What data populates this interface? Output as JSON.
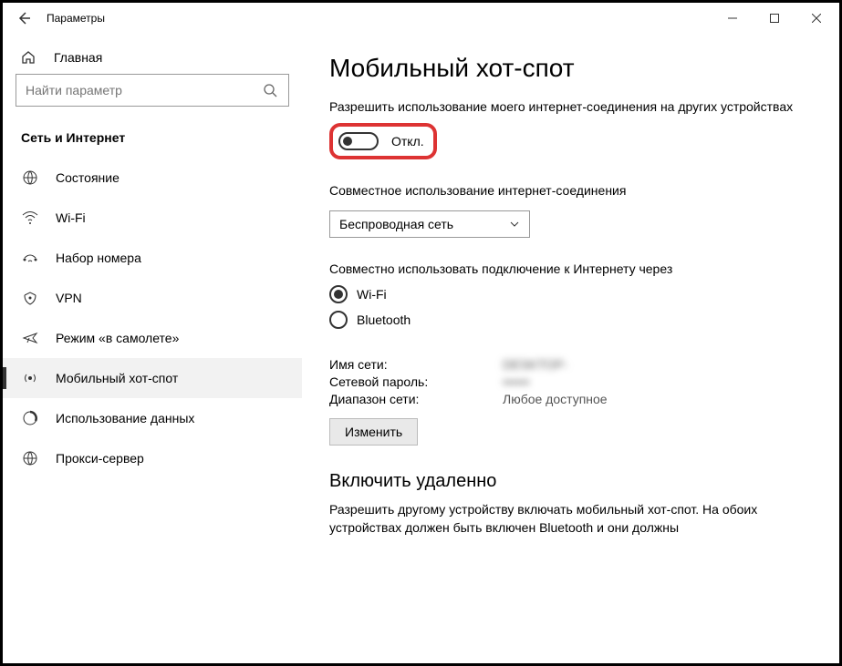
{
  "titlebar": {
    "title": "Параметры"
  },
  "sidebar": {
    "home": "Главная",
    "search_placeholder": "Найти параметр",
    "category": "Сеть и Интернет",
    "items": [
      {
        "label": "Состояние"
      },
      {
        "label": "Wi-Fi"
      },
      {
        "label": "Набор номера"
      },
      {
        "label": "VPN"
      },
      {
        "label": "Режим «в самолете»"
      },
      {
        "label": "Мобильный хот-спот"
      },
      {
        "label": "Использование данных"
      },
      {
        "label": "Прокси-сервер"
      }
    ]
  },
  "page": {
    "heading": "Мобильный хот-спот",
    "share_label": "Разрешить использование моего интернет-соединения на других устройствах",
    "toggle_state": "Откл.",
    "share_from_label": "Совместное использование интернет-соединения",
    "share_from_value": "Беспроводная сеть",
    "share_over_label": "Совместно использовать подключение к Интернету через",
    "radio_wifi": "Wi-Fi",
    "radio_bluetooth": "Bluetooth",
    "kv": {
      "name_k": "Имя сети:",
      "name_v": "DESKTOP-",
      "pass_k": "Сетевой пароль:",
      "pass_v": "••••••",
      "band_k": "Диапазон сети:",
      "band_v": "Любое доступное"
    },
    "edit_btn": "Изменить",
    "remote_heading": "Включить удаленно",
    "remote_desc": "Разрешить другому устройству включать мобильный хот-спот. На обоих устройствах должен быть включен Bluetooth и они должны"
  }
}
